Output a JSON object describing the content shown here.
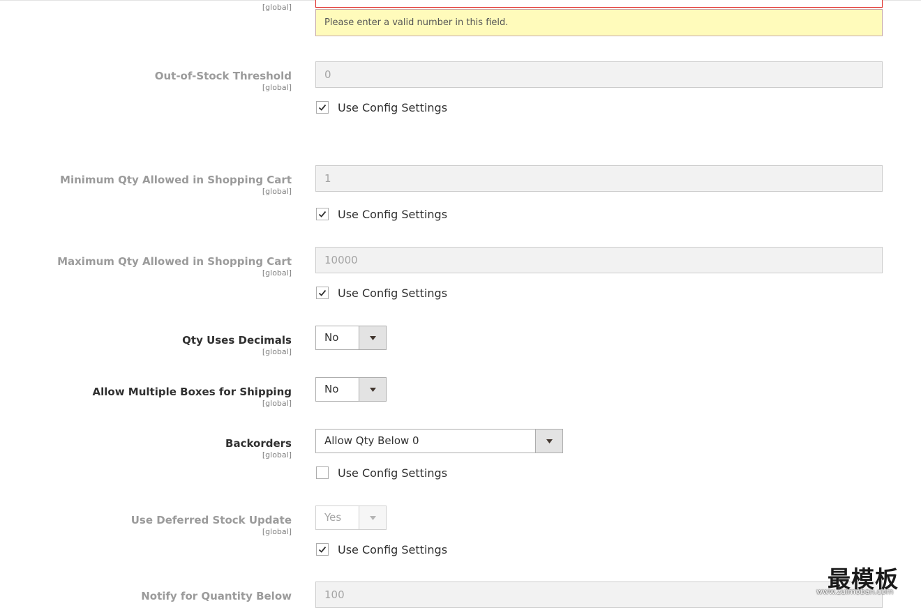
{
  "scope_text": "[global]",
  "top_field": {
    "scope": "[global]",
    "error_message": "Please enter a valid number in this field."
  },
  "fields": {
    "out_of_stock_threshold": {
      "label": "Out-of-Stock Threshold",
      "scope": "[global]",
      "value": "0",
      "use_config_label": "Use Config Settings",
      "use_config_checked": true
    },
    "min_qty_cart": {
      "label": "Minimum Qty Allowed in Shopping Cart",
      "scope": "[global]",
      "value": "1",
      "use_config_label": "Use Config Settings",
      "use_config_checked": true
    },
    "max_qty_cart": {
      "label": "Maximum Qty Allowed in Shopping Cart",
      "scope": "[global]",
      "value": "10000",
      "use_config_label": "Use Config Settings",
      "use_config_checked": true
    },
    "qty_uses_decimals": {
      "label": "Qty Uses Decimals",
      "scope": "[global]",
      "selected": "No"
    },
    "allow_multiple_boxes": {
      "label": "Allow Multiple Boxes for Shipping",
      "scope": "[global]",
      "selected": "No"
    },
    "backorders": {
      "label": "Backorders",
      "scope": "[global]",
      "selected": "Allow Qty Below 0",
      "use_config_label": "Use Config Settings",
      "use_config_checked": false
    },
    "deferred_stock_update": {
      "label": "Use Deferred Stock Update",
      "scope": "[global]",
      "selected": "Yes",
      "use_config_label": "Use Config Settings",
      "use_config_checked": true
    },
    "notify_qty_below": {
      "label": "Notify for Quantity Below",
      "value": "100"
    }
  },
  "watermark": {
    "text": "最模板",
    "url": "www.zuimoban.com"
  },
  "colors": {
    "error_border": "#e02b27",
    "error_background": "#fffbbb",
    "disabled_field": "#f2f2f2",
    "select_button": "#e3e3e3"
  },
  "icons": {
    "checkmark": "check-icon",
    "dropdown": "chevron-down-icon"
  }
}
